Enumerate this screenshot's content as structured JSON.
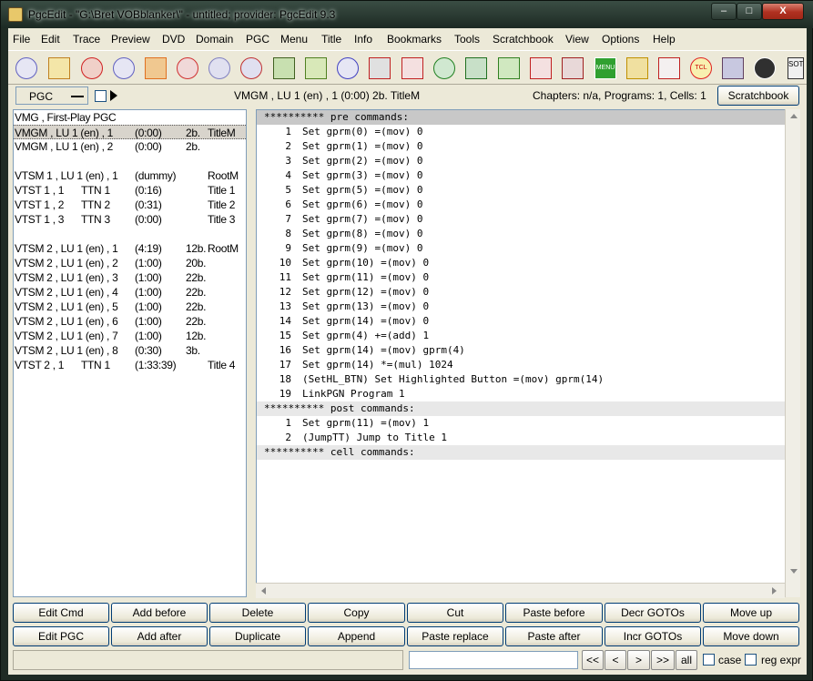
{
  "window": {
    "title": "PgcEdit -   \"G:\\Bret VOBblanker\\\" - untitled; provider: PgcEdit 9.3",
    "min_label": "–",
    "max_label": "□",
    "close_label": "X"
  },
  "menubar": [
    "File",
    "Edit",
    "Trace",
    "Preview",
    "DVD",
    "Domain",
    "PGC",
    "Menu",
    "Title",
    "Info",
    "Bookmarks",
    "Tools",
    "Scratchbook",
    "View",
    "Options",
    "Help"
  ],
  "toolbar": {
    "menu_icon_label": "MENU",
    "tcl_icon_label": "TCL",
    "ok_icon_label": "SOT",
    "icons": [
      "open-dvd-icon",
      "open-folder-icon",
      "reload-icon",
      "burn-dvd-icon",
      "rocket-icon",
      "find-icon",
      "dvd-pair-icon",
      "dvd-arrow-icon",
      "save-icon",
      "save-as-icon",
      "dvd-check-icon",
      "tool-icon",
      "copy-doc-icon",
      "globe-icon",
      "play-film-icon",
      "gear-leaf-icon",
      "checklist-icon",
      "strip-icon",
      "menu-icon",
      "chain-icon",
      "numbers-search-icon",
      "tcl-icon",
      "eye-icon",
      "navigate-icon",
      "sot-icon"
    ]
  },
  "status": {
    "pgc_selector": "PGC",
    "pgc_info": "VMGM , LU 1 (en) , 1   (0:00)  2b.  TitleM",
    "counts": "Chapters: n/a,  Programs: 1,  Cells: 1",
    "scratchbook_button": "Scratchbook"
  },
  "pgc_list": [
    {
      "c1": "VMG , First-Play PGC",
      "c2": "",
      "c3": "",
      "c4": "",
      "c5": "",
      "selected": false
    },
    {
      "c1": "VMGM , LU 1 (en) , 1",
      "c2": "",
      "c3": "(0:00)",
      "c4": "2b.",
      "c5": "TitleM",
      "selected": true
    },
    {
      "c1": "VMGM , LU 1 (en) , 2",
      "c2": "",
      "c3": "(0:00)",
      "c4": "2b.",
      "c5": "",
      "selected": false
    },
    {
      "c1": "",
      "c2": "",
      "c3": "",
      "c4": "",
      "c5": "",
      "selected": false
    },
    {
      "c1": "VTSM 1 , LU 1 (en) , 1",
      "c2": "",
      "c3": "(dummy)",
      "c4": "",
      "c5": "RootM",
      "selected": false
    },
    {
      "c1": "VTST 1 , 1",
      "c2": "TTN 1",
      "c3": "(0:16)",
      "c4": "",
      "c5": "Title 1",
      "selected": false
    },
    {
      "c1": "VTST 1 , 2",
      "c2": "TTN 2",
      "c3": "(0:31)",
      "c4": "",
      "c5": "Title 2",
      "selected": false
    },
    {
      "c1": "VTST 1 , 3",
      "c2": "TTN 3",
      "c3": "(0:00)",
      "c4": "",
      "c5": "Title 3",
      "selected": false
    },
    {
      "c1": "",
      "c2": "",
      "c3": "",
      "c4": "",
      "c5": "",
      "selected": false
    },
    {
      "c1": "VTSM 2 , LU 1 (en) , 1",
      "c2": "",
      "c3": "(4:19)",
      "c4": "12b.",
      "c5": "RootM",
      "selected": false
    },
    {
      "c1": "VTSM 2 , LU 1 (en) , 2",
      "c2": "",
      "c3": "(1:00)",
      "c4": "20b.",
      "c5": "",
      "selected": false
    },
    {
      "c1": "VTSM 2 , LU 1 (en) , 3",
      "c2": "",
      "c3": "(1:00)",
      "c4": "22b.",
      "c5": "",
      "selected": false
    },
    {
      "c1": "VTSM 2 , LU 1 (en) , 4",
      "c2": "",
      "c3": "(1:00)",
      "c4": "22b.",
      "c5": "",
      "selected": false
    },
    {
      "c1": "VTSM 2 , LU 1 (en) , 5",
      "c2": "",
      "c3": "(1:00)",
      "c4": "22b.",
      "c5": "",
      "selected": false
    },
    {
      "c1": "VTSM 2 , LU 1 (en) , 6",
      "c2": "",
      "c3": "(1:00)",
      "c4": "22b.",
      "c5": "",
      "selected": false
    },
    {
      "c1": "VTSM 2 , LU 1 (en) , 7",
      "c2": "",
      "c3": "(1:00)",
      "c4": "12b.",
      "c5": "",
      "selected": false
    },
    {
      "c1": "VTSM 2 , LU 1 (en) , 8",
      "c2": "",
      "c3": "(0:30)",
      "c4": "3b.",
      "c5": "",
      "selected": false
    },
    {
      "c1": "VTST 2 , 1",
      "c2": "TTN 1",
      "c3": "(1:33:39)",
      "c4": "",
      "c5": "Title 4",
      "selected": false
    }
  ],
  "commands": [
    {
      "kind": "hdr",
      "text": "********** pre commands:"
    },
    {
      "kind": "cmd",
      "num": "1",
      "text": "Set gprm(0) =(mov) 0"
    },
    {
      "kind": "cmd",
      "num": "2",
      "text": "Set gprm(1) =(mov) 0"
    },
    {
      "kind": "cmd",
      "num": "3",
      "text": "Set gprm(2) =(mov) 0"
    },
    {
      "kind": "cmd",
      "num": "4",
      "text": "Set gprm(3) =(mov) 0"
    },
    {
      "kind": "cmd",
      "num": "5",
      "text": "Set gprm(5) =(mov) 0"
    },
    {
      "kind": "cmd",
      "num": "6",
      "text": "Set gprm(6) =(mov) 0"
    },
    {
      "kind": "cmd",
      "num": "7",
      "text": "Set gprm(7) =(mov) 0"
    },
    {
      "kind": "cmd",
      "num": "8",
      "text": "Set gprm(8) =(mov) 0"
    },
    {
      "kind": "cmd",
      "num": "9",
      "text": "Set gprm(9) =(mov) 0"
    },
    {
      "kind": "cmd",
      "num": "10",
      "text": "Set gprm(10) =(mov) 0"
    },
    {
      "kind": "cmd",
      "num": "11",
      "text": "Set gprm(11) =(mov) 0"
    },
    {
      "kind": "cmd",
      "num": "12",
      "text": "Set gprm(12) =(mov) 0"
    },
    {
      "kind": "cmd",
      "num": "13",
      "text": "Set gprm(13) =(mov) 0"
    },
    {
      "kind": "cmd",
      "num": "14",
      "text": "Set gprm(14) =(mov) 0"
    },
    {
      "kind": "cmd",
      "num": "15",
      "text": "Set gprm(4) +=(add) 1"
    },
    {
      "kind": "cmd",
      "num": "16",
      "text": "Set gprm(14) =(mov) gprm(4)"
    },
    {
      "kind": "cmd",
      "num": "17",
      "text": "Set gprm(14) *=(mul) 1024"
    },
    {
      "kind": "cmd",
      "num": "18",
      "text": "(SetHL_BTN) Set Highlighted Button =(mov) gprm(14)"
    },
    {
      "kind": "cmd",
      "num": "19",
      "text": "LinkPGN Program 1"
    },
    {
      "kind": "hdr2",
      "text": "********** post commands:"
    },
    {
      "kind": "cmd",
      "num": "1",
      "text": "Set gprm(11) =(mov) 1"
    },
    {
      "kind": "cmd",
      "num": "2",
      "text": "(JumpTT) Jump to Title 1"
    },
    {
      "kind": "hdr2",
      "text": "********** cell commands:"
    }
  ],
  "buttons_row1": [
    "Edit Cmd",
    "Add before",
    "Delete",
    "Copy",
    "Cut",
    "Paste before",
    "Decr GOTOs",
    "Move up"
  ],
  "buttons_row2": [
    "Edit PGC",
    "Add after",
    "Duplicate",
    "Append",
    "Paste replace",
    "Paste after",
    "Incr GOTOs",
    "Move down"
  ],
  "search": {
    "value": "",
    "nav": [
      "<<",
      "<",
      ">",
      ">>",
      "all"
    ],
    "case_label": "case",
    "regexpr_label": "reg expr"
  },
  "colors": {
    "window_frame": "#1f2b24",
    "client_bg": "#ece9d8",
    "header_bg": "#c8c8c8",
    "selected_row": "#d8d4cc",
    "close_red": "#b03020"
  }
}
